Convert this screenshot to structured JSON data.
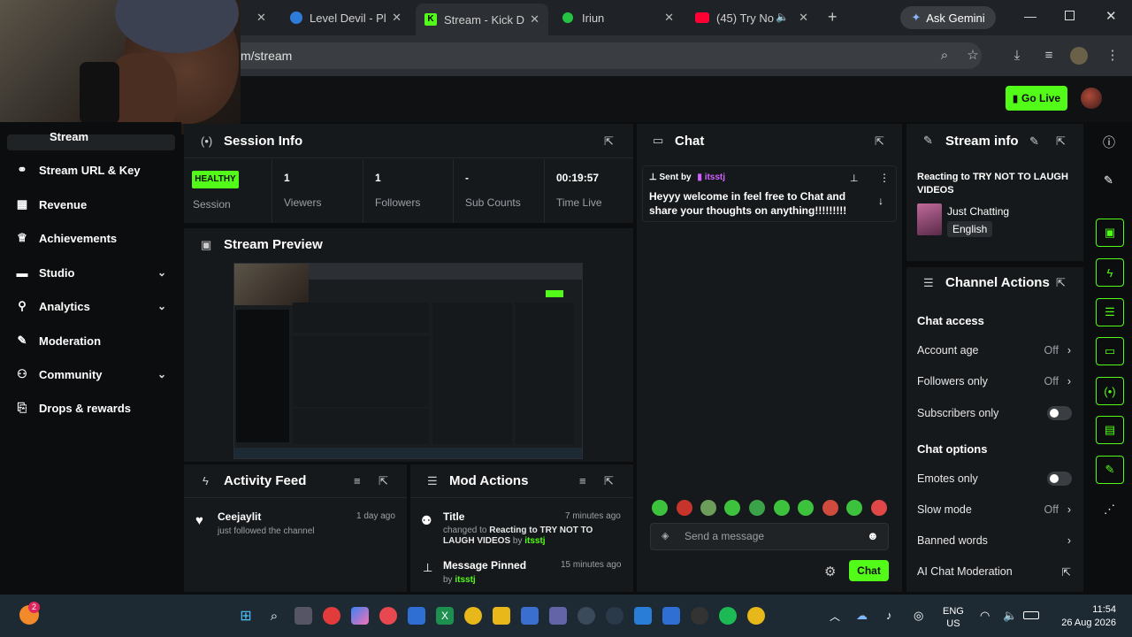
{
  "browser": {
    "tabs": [
      {
        "label": "Level Devil - Pl",
        "icon": "edge-icon"
      },
      {
        "label": "Stream - Kick D",
        "icon": "kick-icon"
      },
      {
        "label": "Iriun",
        "icon": "green-dot-icon"
      },
      {
        "label": "(45) Try No",
        "icon": "youtube-icon"
      }
    ],
    "gemini_label": "Ask Gemini",
    "address": "m/stream"
  },
  "topnav": {
    "go_live": "Go Live"
  },
  "sidebar": {
    "items": [
      {
        "label": "Stream",
        "icon": "broadcast-icon"
      },
      {
        "label": "Stream URL & Key",
        "icon": "link-icon"
      },
      {
        "label": "Revenue",
        "icon": "revenue-icon"
      },
      {
        "label": "Achievements",
        "icon": "trophy-icon"
      },
      {
        "label": "Studio",
        "icon": "studio-icon"
      },
      {
        "label": "Analytics",
        "icon": "analytics-icon"
      },
      {
        "label": "Moderation",
        "icon": "wrench-icon"
      },
      {
        "label": "Community",
        "icon": "community-icon"
      },
      {
        "label": "Drops & rewards",
        "icon": "gift-icon"
      }
    ]
  },
  "session_info": {
    "title": "Session Info",
    "health_badge": "HEALTHY",
    "health_label": "Session",
    "stats": [
      {
        "value": "1",
        "label": "Viewers"
      },
      {
        "value": "1",
        "label": "Followers"
      },
      {
        "value": "-",
        "label": "Sub Counts"
      },
      {
        "value": "00:19:57",
        "label": "Time Live"
      }
    ]
  },
  "stream_preview": {
    "title": "Stream Preview"
  },
  "activity_feed": {
    "title": "Activity Feed",
    "items": [
      {
        "name": "Ceejaylit",
        "desc": "just followed the channel",
        "time": "1 day ago"
      }
    ]
  },
  "mod_actions": {
    "title": "Mod Actions",
    "items": [
      {
        "title": "Title",
        "line1": "changed to ",
        "bold1": "Reacting to TRY NOT TO LAUGH VIDEOS",
        "by": " by ",
        "user": "itsstj",
        "time": "7 minutes ago"
      },
      {
        "title": "Message Pinned",
        "line1": "by ",
        "user": "itsstj",
        "time": "15 minutes ago"
      }
    ]
  },
  "chat": {
    "title": "Chat",
    "pinned_sent_by": "Sent by",
    "pinned_user": "itsstj",
    "pinned_message": "Heyyy welcome in feel free to Chat and share your thoughts on anything!!!!!!!!!",
    "input_placeholder": "Send a message",
    "send_label": "Chat"
  },
  "stream_info": {
    "title": "Stream info",
    "stream_title": "Reacting to TRY NOT TO LAUGH VIDEOS",
    "category": "Just Chatting",
    "language": "English"
  },
  "channel_actions": {
    "title": "Channel Actions",
    "chat_access_heading": "Chat access",
    "account_age": "Account age",
    "account_age_value": "Off",
    "followers_only": "Followers only",
    "followers_only_value": "Off",
    "subscribers_only": "Subscribers only",
    "chat_options_heading": "Chat options",
    "emotes_only": "Emotes only",
    "slow_mode": "Slow mode",
    "slow_mode_value": "Off",
    "banned_words": "Banned words",
    "ai_chat_moderation": "AI Chat Moderation"
  },
  "taskbar": {
    "notification_count": "2",
    "language_line1": "ENG",
    "language_line2": "US",
    "time": "11:54",
    "date": "26 Aug 2026"
  },
  "colors": {
    "accent": "#53fc18",
    "panel": "#16191b",
    "background": "#0b0d0e"
  }
}
